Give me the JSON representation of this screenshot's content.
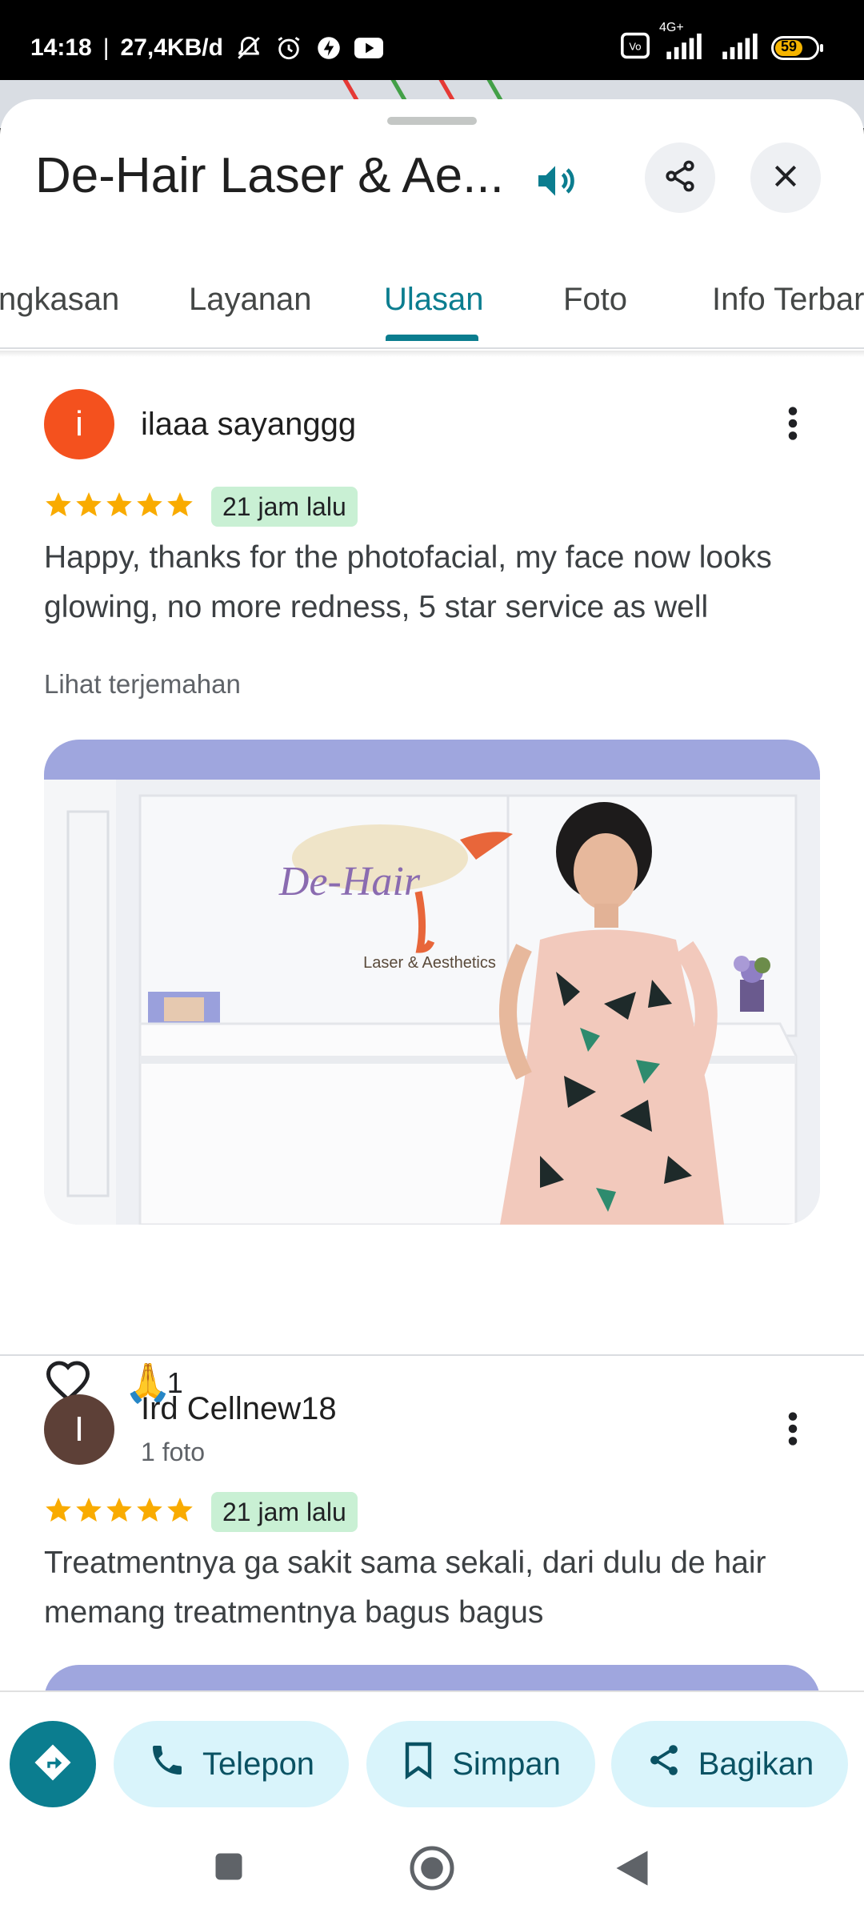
{
  "status_bar": {
    "time": "14:18",
    "speed": "27,4KB/d",
    "network": "4G+",
    "battery": "59"
  },
  "place": {
    "title": "De-Hair Laser & Ae..."
  },
  "tabs": [
    {
      "label": "ngkasan"
    },
    {
      "label": "Layanan"
    },
    {
      "label": "Ulasan"
    },
    {
      "label": "Foto"
    },
    {
      "label": "Info Terbar"
    }
  ],
  "reviews": [
    {
      "avatar_letter": "i",
      "avatar_color": "#f4511e",
      "name": "ilaaa sayanggg",
      "rating": 5,
      "time": "21 jam lalu",
      "text": "Happy, thanks for the photofacial, my face now looks glowing, no more redness, 5 star service as well",
      "translate_label": "Lihat terjemahan",
      "photo": {
        "logo_text": "De-Hair",
        "logo_sub": "Laser & Aesthetics"
      },
      "reaction_emoji": "🙏",
      "reaction_count": "1"
    },
    {
      "avatar_letter": "I",
      "avatar_color": "#5d4037",
      "name": "Ird Cellnew18",
      "meta": "1 foto",
      "rating": 5,
      "time": "21 jam lalu",
      "text": "Treatmentnya ga sakit sama sekali, dari dulu de hair memang treatmentnya bagus bagus"
    }
  ],
  "actions": {
    "call": "Telepon",
    "save": "Simpan",
    "share": "Bagikan"
  },
  "colors": {
    "accent": "#0b7d8f",
    "pill_bg": "#d9f4fb",
    "star": "#f9ab00",
    "badge_bg": "#c9f0d4"
  }
}
